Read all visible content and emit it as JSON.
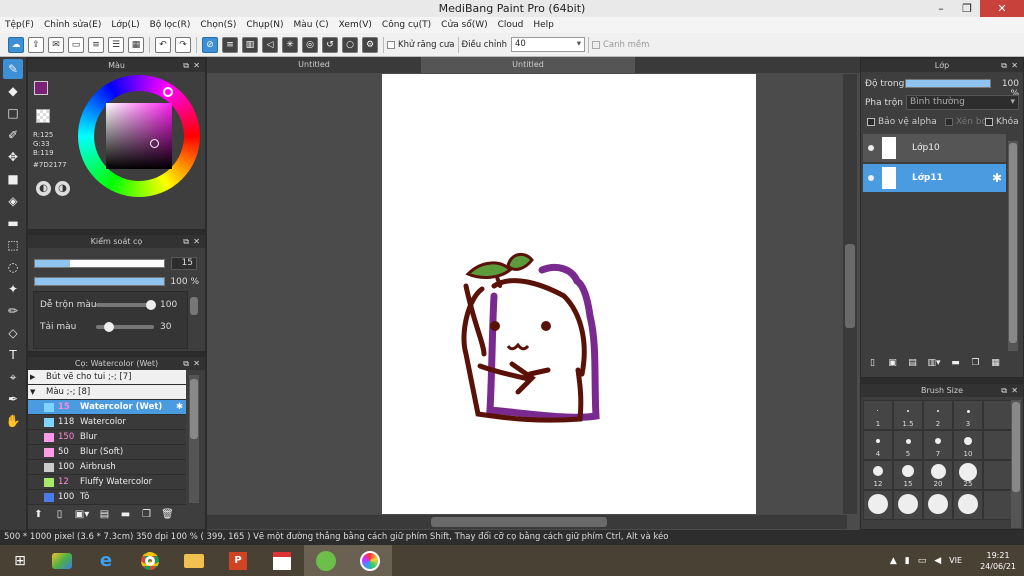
{
  "window": {
    "title": "MediBang Paint Pro (64bit)",
    "minimize": "–",
    "restore": "❐",
    "close": "✕"
  },
  "menu": [
    "Tệp(F)",
    "Chỉnh sửa(E)",
    "Lớp(L)",
    "Bộ lọc(R)",
    "Chọn(S)",
    "Chụp(N)",
    "Màu (C)",
    "Xem(V)",
    "Công cụ(T)",
    "Cửa sổ(W)",
    "Cloud",
    "Help"
  ],
  "toolbar": {
    "antialias_label": "Khử răng cưa",
    "adjust_label": "Điều chỉnh",
    "adjust_value": "40",
    "snap_label": "Canh mềm"
  },
  "color_panel": {
    "title": "Màu",
    "r": "R:125",
    "g": "G:33",
    "b": "B:119",
    "hex": "#7D2177",
    "primary_color": "#7d2177"
  },
  "brush_control": {
    "title": "Kiểm soát cọ",
    "size_value": "15",
    "size_fraction": 0.27,
    "opacity_value": "100 %",
    "blend_label": "Dễ trộn màu",
    "blend_value": "100",
    "load_label": "Tải màu",
    "load_value": "30"
  },
  "brush_list": {
    "title": "Cọ: Watercolor (Wet)",
    "groups": [
      {
        "label": "Bút vẽ cho tui ;-; [7]",
        "arrow": "▶"
      },
      {
        "label": "Màu ;-; [8]",
        "arrow": "▼"
      }
    ],
    "items": [
      {
        "num": "15",
        "name": "Watercolor (Wet)",
        "color": "#7fd3ff",
        "selected": true
      },
      {
        "num": "118",
        "name": "Watercolor",
        "color": "#7fd3ff"
      },
      {
        "num": "150",
        "name": "Blur",
        "color": "#ff9be8"
      },
      {
        "num": "50",
        "name": "Blur (Soft)",
        "color": "#ff9be8"
      },
      {
        "num": "100",
        "name": "Airbrush",
        "color": "#cccccc"
      },
      {
        "num": "12",
        "name": "Fluffy Watercolor",
        "color": "#a8e86a"
      },
      {
        "num": "100",
        "name": "Tô",
        "color": "#4a7bea"
      }
    ]
  },
  "tabs": [
    "Untitled",
    "Untitled"
  ],
  "layer_panel": {
    "title": "Lớp",
    "opacity_label": "Độ trong",
    "opacity_value": "100 %",
    "blend_label": "Pha trộn",
    "blend_value": "Bình thường",
    "protect_alpha": "Bảo vệ alpha",
    "clip": "Xén bớt",
    "lock": "Khóa",
    "layers": [
      {
        "name": "Lớp10",
        "selected": false
      },
      {
        "name": "Lớp11",
        "selected": true
      }
    ]
  },
  "brush_size": {
    "title": "Brush Size",
    "sizes": [
      "1",
      "1.5",
      "2",
      "3",
      "4",
      "5",
      "7",
      "10",
      "12",
      "15",
      "20",
      "25"
    ]
  },
  "status": {
    "text": "500 * 1000 pixel   (3.6 * 7.3cm)   350 dpi   100 %   ( 399, 165 )   Vẽ một đường thẳng bằng cách giữ phím Shift, Thay đổi cỡ cọ bằng cách giữ phím Ctrl, Alt và kéo"
  },
  "taskbar": {
    "lang": "VIE",
    "time": "19:21",
    "date": "24/06/21"
  }
}
